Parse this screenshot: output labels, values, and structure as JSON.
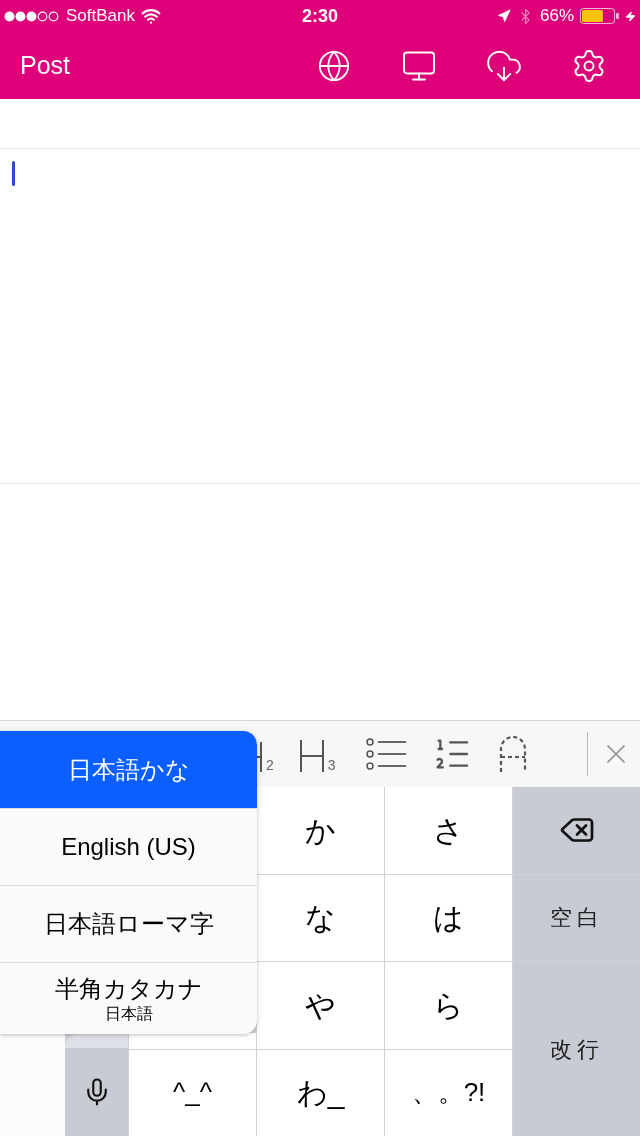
{
  "status_bar": {
    "carrier": "SoftBank",
    "time": "2:30",
    "battery": "66%"
  },
  "nav_bar": {
    "title": "Post"
  },
  "format_toolbar": {
    "items": [
      {
        "kind": "heading_partial",
        "sub": "2"
      },
      {
        "kind": "heading",
        "sub": "3"
      },
      {
        "kind": "bullet_list"
      },
      {
        "kind": "numbered_list"
      },
      {
        "kind": "style"
      },
      {
        "kind": "close"
      }
    ]
  },
  "input_mode_menu": {
    "items": [
      {
        "label": "日本語かな",
        "selected": true
      },
      {
        "label": "English (US)",
        "selected": false
      },
      {
        "label": "日本語ローマ字",
        "selected": false
      },
      {
        "label": "半角カタカナ",
        "sublabel": "日本語",
        "selected": false
      }
    ]
  },
  "keyboard": {
    "keys": [
      {
        "kind": "char",
        "label": "か"
      },
      {
        "kind": "char",
        "label": "さ"
      },
      {
        "kind": "backspace"
      },
      {
        "kind": "char",
        "label": "な"
      },
      {
        "kind": "char",
        "label": "は"
      },
      {
        "kind": "space",
        "label": "空白"
      },
      {
        "kind": "char",
        "label": "や"
      },
      {
        "kind": "char",
        "label": "ら"
      },
      {
        "kind": "return",
        "label": "改行"
      },
      {
        "kind": "mic"
      },
      {
        "kind": "symbol",
        "label": "^_^"
      },
      {
        "kind": "char",
        "label": "わ_"
      },
      {
        "kind": "symbol",
        "label": "、。?!"
      }
    ]
  }
}
